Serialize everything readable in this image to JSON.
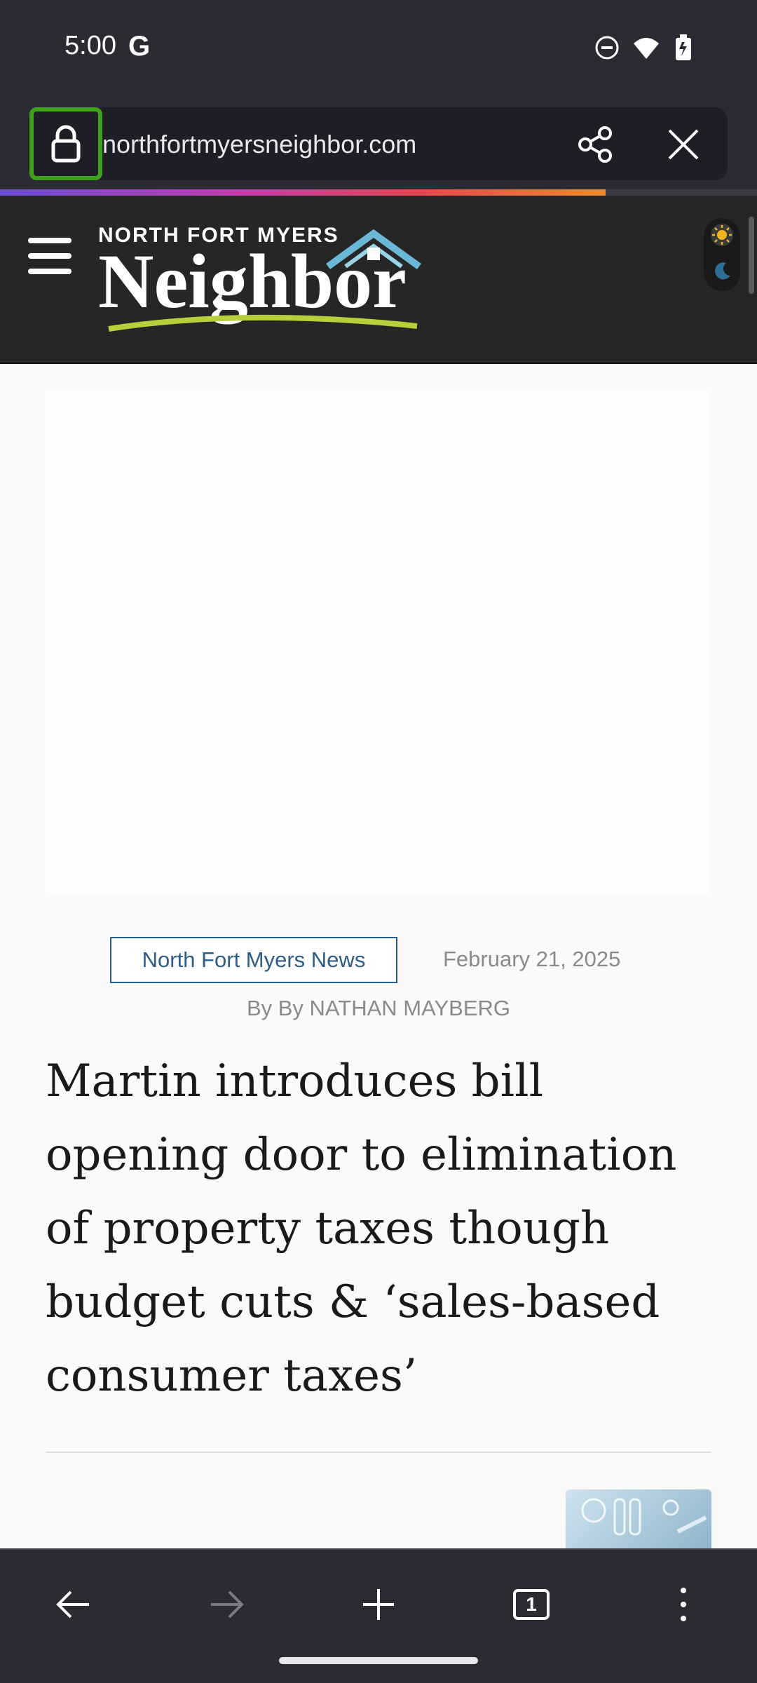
{
  "status_bar": {
    "time": "5:00",
    "g_label": "G"
  },
  "browser": {
    "url": "northfortmyersneighbor.com",
    "page_load_progress": 0.8
  },
  "site": {
    "logo_top": "NORTH FORT MYERS",
    "logo_main": "Neighbor"
  },
  "article": {
    "category": "North Fort Myers News",
    "date": "February 21, 2025",
    "byline": "By By NATHAN MAYBERG",
    "headline": "Martin introduces bill opening door to elimination of property taxes though budget cuts & ‘sales-based consumer taxes’"
  },
  "bottom_nav": {
    "tab_count": "1"
  },
  "colors": {
    "highlight": "#3fa11a",
    "badge_blue": "#2a5d8a"
  },
  "icons": [
    "dnd-icon",
    "wifi-icon",
    "battery-icon",
    "lock-icon",
    "share-icon",
    "close-icon",
    "menu-icon",
    "sun-icon",
    "moon-icon",
    "back-icon",
    "forward-icon",
    "new-tab-icon",
    "tabs-icon",
    "more-icon"
  ]
}
